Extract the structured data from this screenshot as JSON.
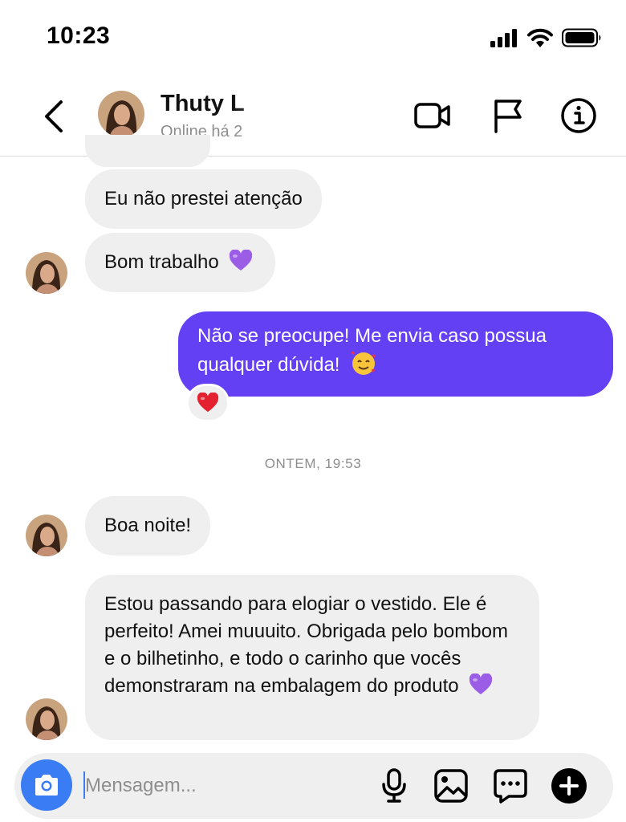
{
  "status_bar": {
    "time": "10:23"
  },
  "header": {
    "contact_name": "Thuty L",
    "contact_status": "Online há 2"
  },
  "messages": [
    {
      "from": "contact",
      "text": "Eu não prestei atenção"
    },
    {
      "from": "contact",
      "text": "Bom trabalho"
    },
    {
      "from": "me",
      "text": "Não se preocupe! Me envia caso possua qualquer dúvida!",
      "reaction": "heart"
    },
    {
      "from": "contact",
      "text": "Boa noite!"
    },
    {
      "from": "contact",
      "text": "Estou passando para elogiar o vestido. Ele é perfeito! Amei muuuito. Obrigada pelo bombom e o bilhetinho, e todo o carinho que vocês demonstraram na embalagem do produto"
    }
  ],
  "timestamp": "ONTEM, 19:53",
  "composer": {
    "placeholder": "Mensagem..."
  },
  "icons": {
    "signal": "cellular-signal-icon",
    "wifi": "wifi-icon",
    "battery": "battery-icon",
    "back": "chevron-left-icon",
    "video": "video-camera-icon",
    "flag": "flag-icon",
    "info": "info-icon",
    "camera": "camera-icon",
    "mic": "microphone-icon",
    "gallery": "image-icon",
    "sticker": "message-dots-icon",
    "plus": "plus-icon",
    "purple_heart": "purple-heart-emoji",
    "smiling_hearts": "smiling-face-hearts-emoji",
    "red_heart": "red-heart-emoji"
  },
  "colors": {
    "outgoing_bubble": "#6440f5",
    "incoming_bubble": "#efefef",
    "camera_button": "#3a7cf4",
    "muted_text": "#8e8e8e"
  }
}
